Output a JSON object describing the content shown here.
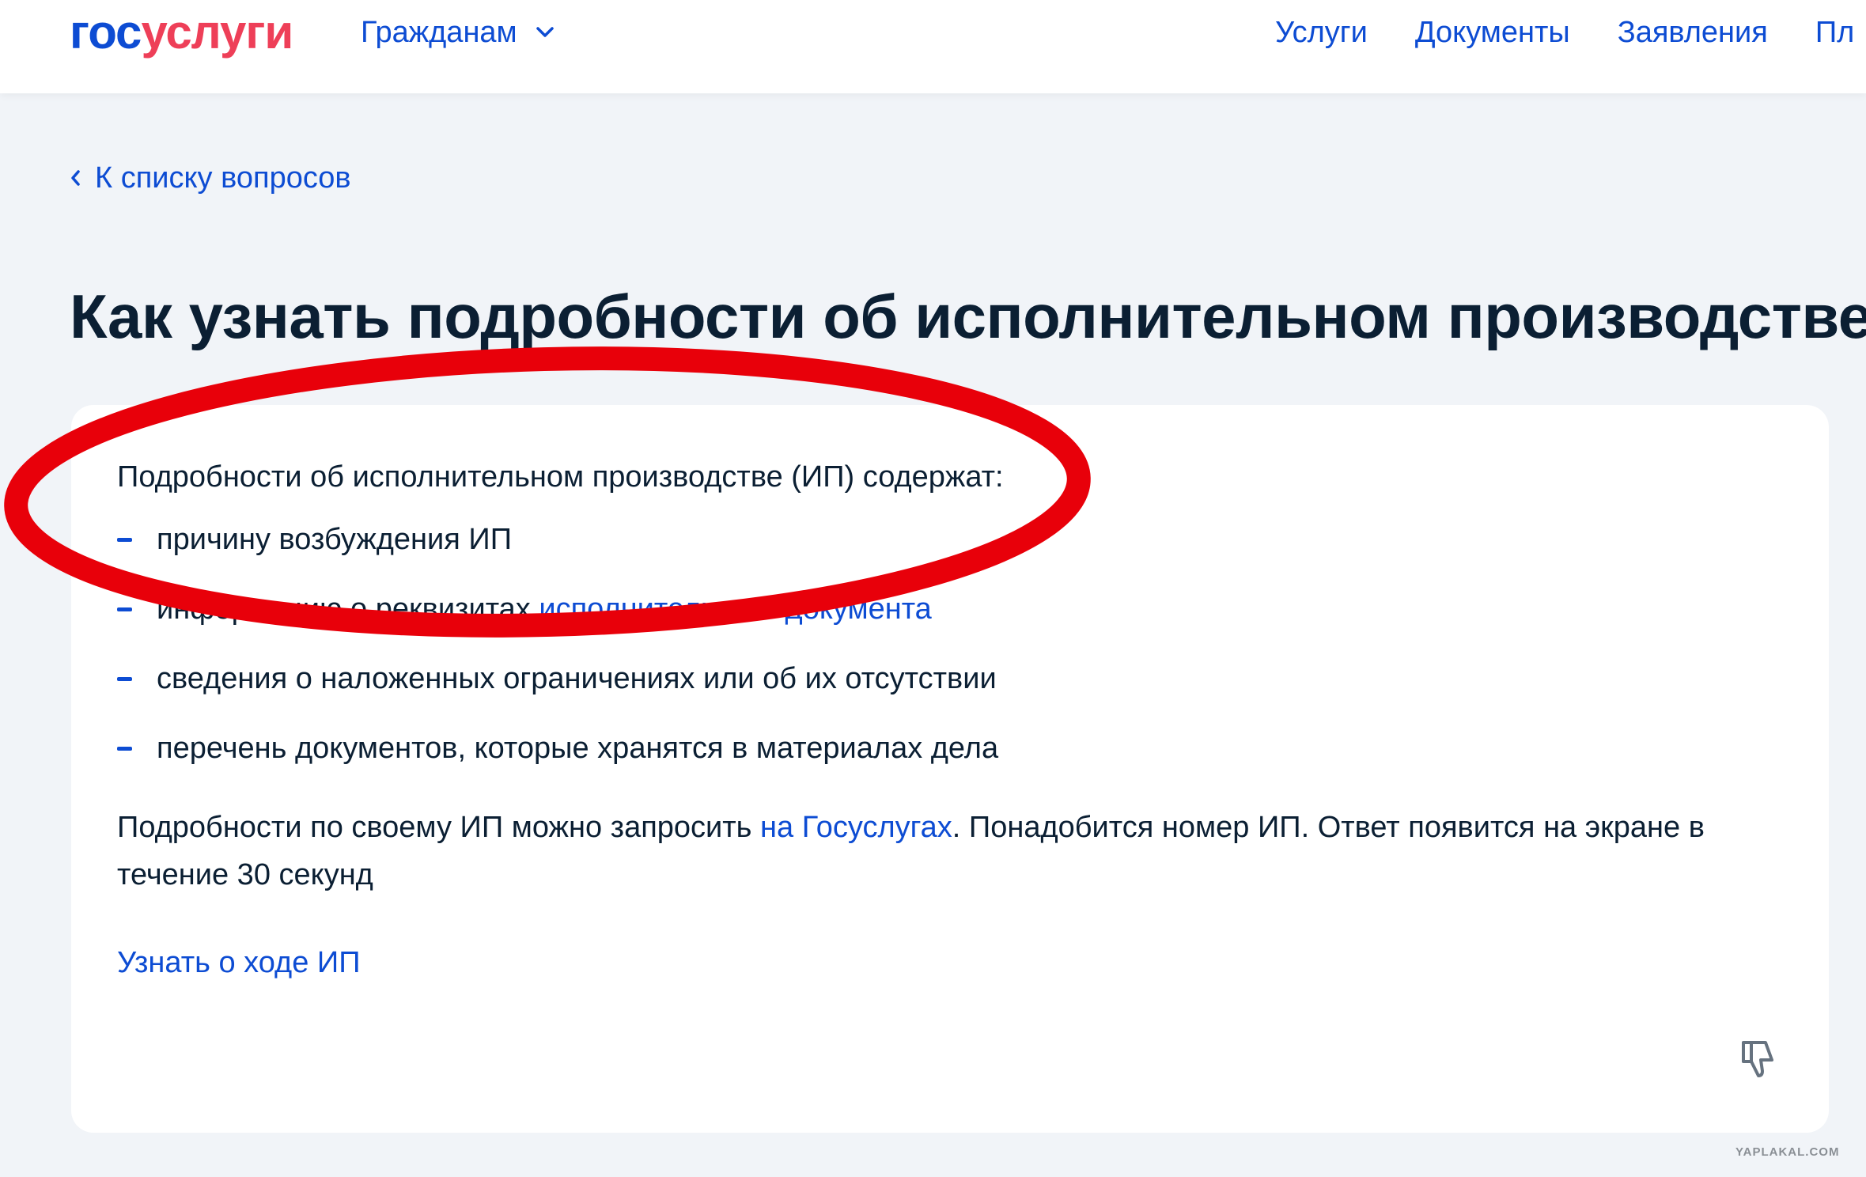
{
  "header": {
    "logo": {
      "part1": "гос",
      "part2": "услуги"
    },
    "citizens_menu": "Гражданам",
    "nav": [
      "Услуги",
      "Документы",
      "Заявления",
      "Пл"
    ]
  },
  "back_link": "К списку вопросов",
  "page_title": "Как узнать подробности об исполнительном производстве",
  "card": {
    "intro": "Подробности об исполнительном производстве (ИП) содержат:",
    "bullets": [
      {
        "text": "причину возбуждения ИП",
        "link": ""
      },
      {
        "text": "информацию о реквизитах ",
        "link": "исполнительного документа"
      },
      {
        "text": "сведения о наложенных ограничениях или об их отсутствии",
        "link": ""
      },
      {
        "text": "перечень документов, которые хранятся в материалах дела",
        "link": ""
      }
    ],
    "para": {
      "before": "Подробности по своему ИП можно запросить ",
      "link": "на Госуслугах",
      "after": ". Понадобится номер ИП. Ответ появится на экране в течение 30 секунд"
    },
    "cta": "Узнать о ходе ИП"
  },
  "watermark": "YAPLAKAL.COM",
  "colors": {
    "brand_blue": "#0d4cd3",
    "brand_red": "#ee3f58",
    "text": "#0b1f33",
    "background": "#f1f4f8",
    "annotation_red": "#e8000a"
  },
  "icons": {
    "menu_chevron": "chevron-down-icon",
    "back": "chevron-left-icon",
    "feedback": "thumbs-down-icon"
  }
}
